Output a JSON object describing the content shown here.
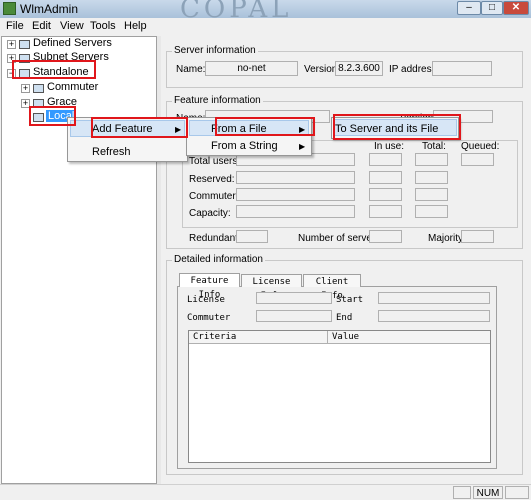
{
  "window": {
    "title": "WlmAdmin",
    "decoration_text": "COPAL"
  },
  "title_buttons": {
    "minimize": "–",
    "maximize": "□",
    "close": "✕"
  },
  "menubar": [
    "File",
    "Edit",
    "View",
    "Tools",
    "Help"
  ],
  "tree": {
    "items": [
      {
        "label": "Defined Servers"
      },
      {
        "label": "Subnet Servers"
      },
      {
        "label": "Standalone"
      },
      {
        "label": "Commuter"
      },
      {
        "label": "Grace"
      },
      {
        "label": "Local"
      }
    ],
    "expand_symbol": "+",
    "collapse_symbol": "−"
  },
  "server_info": {
    "title": "Server information",
    "name_label": "Name:",
    "name_value": "no-net",
    "version_label": "Version:",
    "version_value": "8.2.3.600",
    "ip_label": "IP address:",
    "ip_value": ""
  },
  "feature_info": {
    "title": "Feature information",
    "name_label": "Name:",
    "version_label": "Version:",
    "col_in_use": "In use:",
    "col_total": "Total:",
    "col_queued": "Queued:",
    "rows": [
      "Total users:",
      "Reserved:",
      "Commuter:",
      "Capacity:"
    ],
    "redundant_label": "Redundant:",
    "num_servers_label": "Number of servers:",
    "majority_label": "Majority:"
  },
  "detailed_info": {
    "title": "Detailed information",
    "tabs": [
      "Feature Info",
      "License Info",
      "Client Info"
    ],
    "license_label": "License",
    "start_label": "Start",
    "commuter_label": "Commuter",
    "end_label": "End",
    "list_columns": [
      "Criteria",
      "Value"
    ]
  },
  "context_menu": {
    "items": [
      "Add Feature",
      "Refresh"
    ],
    "submenu": [
      "From a File",
      "From a String"
    ],
    "subsubmenu": [
      "To Server and its File"
    ],
    "arrow": "▶"
  },
  "statusbar": {
    "num": "NUM"
  },
  "colors": {
    "annotation": "#e0161b",
    "selection": "#3399ff",
    "menu_highlight": "#d7e6f6"
  }
}
